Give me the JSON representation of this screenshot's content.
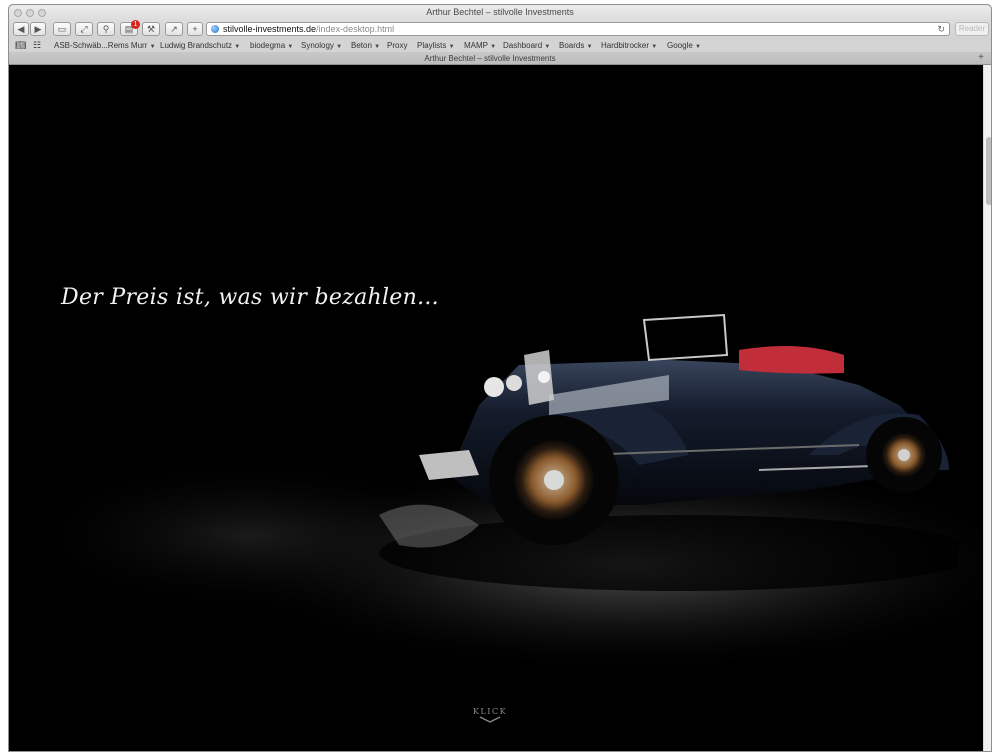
{
  "window": {
    "title": "Arthur Bechtel – stilvolle Investments",
    "tab_title": "Arthur Bechtel – stilvolle Investments"
  },
  "toolbar": {
    "back_icon": "back-arrow-icon",
    "forward_icon": "forward-arrow-icon",
    "notification_count": "1",
    "url_host": "stilvolle-investments.de",
    "url_path": "/index-desktop.html",
    "reader_label": "Reader"
  },
  "bookmarks": [
    {
      "label": "ASB-Schwäb...Rems Murr",
      "has_menu": true
    },
    {
      "label": "Ludwig Brandschutz",
      "has_menu": true
    },
    {
      "label": "biodegma",
      "has_menu": true
    },
    {
      "label": "Synology",
      "has_menu": true
    },
    {
      "label": "Beton",
      "has_menu": true
    },
    {
      "label": "Proxy",
      "has_menu": false
    },
    {
      "label": "Playlists",
      "has_menu": true
    },
    {
      "label": "MAMP",
      "has_menu": true
    },
    {
      "label": "Dashboard",
      "has_menu": true
    },
    {
      "label": "Boards",
      "has_menu": true
    },
    {
      "label": "Hardbitrocker",
      "has_menu": true
    },
    {
      "label": "Google",
      "has_menu": true
    }
  ],
  "page": {
    "headline": "Der Preis ist, was wir bezahlen...",
    "cta_label": "KLICK",
    "background_color": "#000000"
  }
}
